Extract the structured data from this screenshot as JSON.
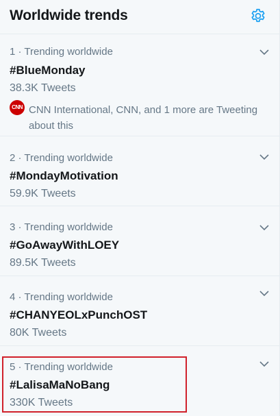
{
  "header": {
    "title": "Worldwide trends",
    "settings_icon": "gear-icon",
    "accent_color": "#1da1f2"
  },
  "trends": [
    {
      "meta": "1 · Trending worldwide",
      "name": "#BlueMonday",
      "count": "38.3K Tweets",
      "context": {
        "icon": "cnn-logo",
        "logo_text": "CNN",
        "text": "CNN International, CNN, and 1 more are Tweeting about this"
      }
    },
    {
      "meta": "2 · Trending worldwide",
      "name": "#MondayMotivation",
      "count": "59.9K Tweets"
    },
    {
      "meta": "3 · Trending worldwide",
      "name": "#GoAwayWithLOEY",
      "count": "89.5K Tweets"
    },
    {
      "meta": "4 · Trending worldwide",
      "name": "#CHANYEOLxPunchOST",
      "count": "80K Tweets"
    },
    {
      "meta": "5 · Trending worldwide",
      "name": "#LalisaMaNoBang",
      "count": "330K Tweets"
    }
  ],
  "annotation": {
    "highlight_color": "#d0202a",
    "highlighted_trend": 5
  }
}
